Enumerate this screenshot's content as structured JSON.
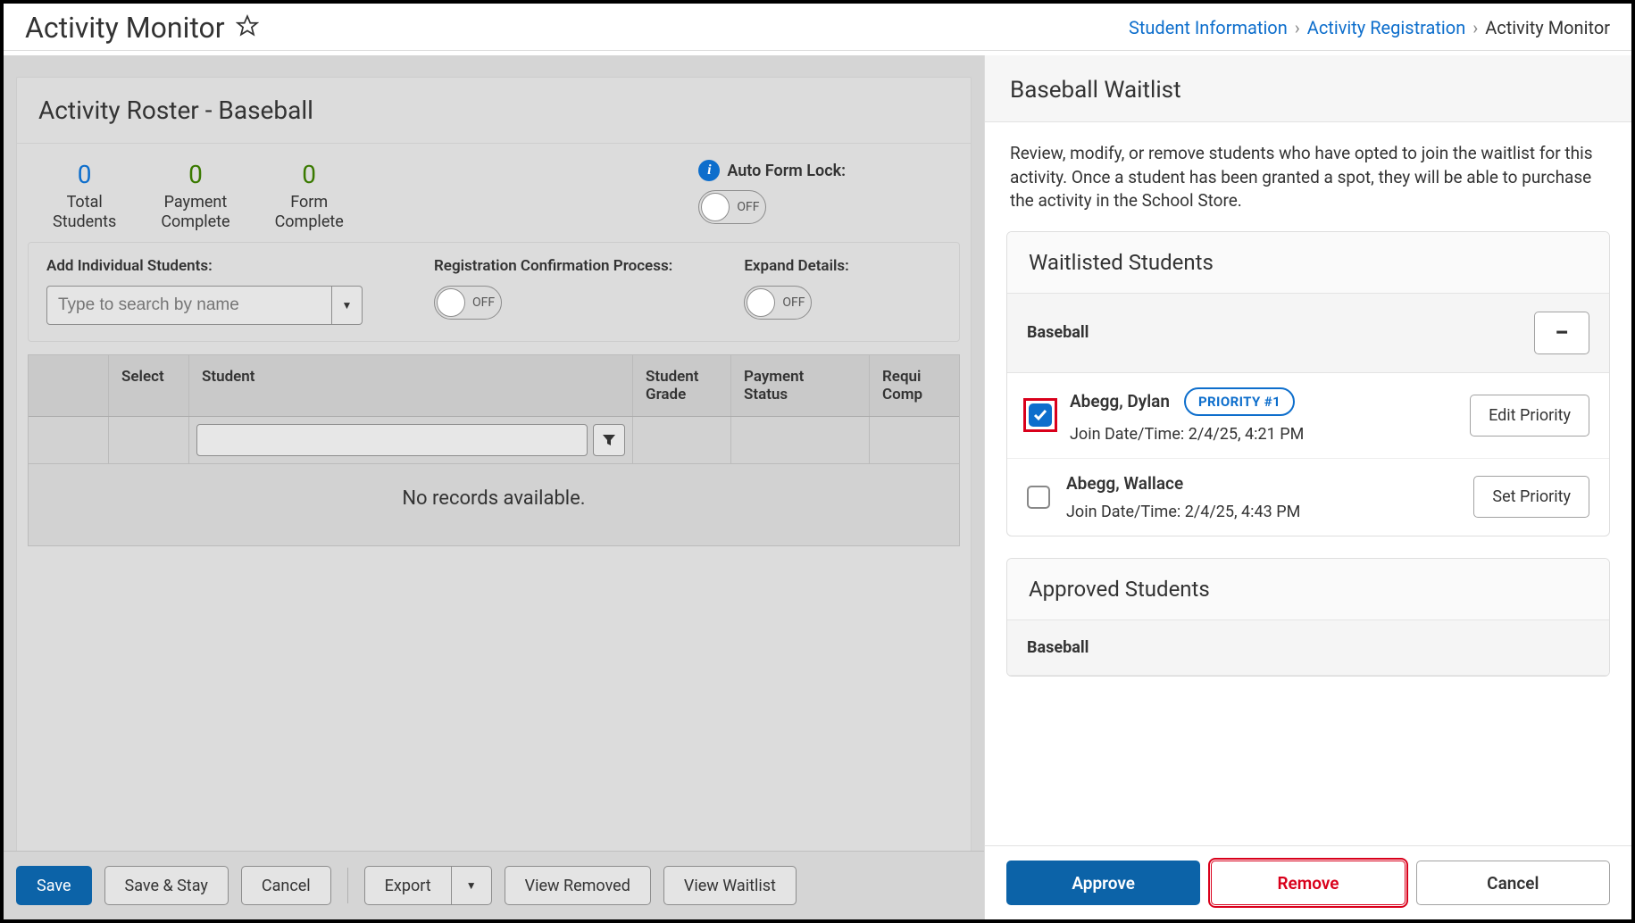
{
  "header": {
    "title": "Activity Monitor",
    "breadcrumbs": {
      "items": [
        {
          "label": "Student Information",
          "link": true
        },
        {
          "label": "Activity Registration",
          "link": true
        },
        {
          "label": "Activity Monitor",
          "link": false
        }
      ]
    }
  },
  "roster": {
    "title": "Activity Roster - Baseball",
    "stats": [
      {
        "value": "0",
        "label_line1": "Total",
        "label_line2": "Students",
        "color": "blue"
      },
      {
        "value": "0",
        "label_line1": "Payment",
        "label_line2": "Complete",
        "color": "green"
      },
      {
        "value": "0",
        "label_line1": "Form",
        "label_line2": "Complete",
        "color": "green"
      }
    ],
    "auto_form_lock": {
      "label": "Auto Form Lock:",
      "state": "OFF"
    },
    "add_students": {
      "label": "Add Individual Students:",
      "placeholder": "Type to search by name"
    },
    "reg_confirm": {
      "label": "Registration Confirmation Process:",
      "state": "OFF"
    },
    "expand_details": {
      "label": "Expand Details:",
      "state": "OFF"
    },
    "table": {
      "headers": {
        "select": "Select",
        "student": "Student",
        "grade": "Student Grade",
        "payment": "Payment Status",
        "required": "Requi\nComp"
      },
      "no_records": "No records available."
    }
  },
  "left_footer": {
    "save": "Save",
    "save_stay": "Save & Stay",
    "cancel": "Cancel",
    "export": "Export",
    "view_removed": "View Removed",
    "view_waitlist": "View Waitlist"
  },
  "waitlist_panel": {
    "title": "Baseball Waitlist",
    "description": "Review, modify, or remove students who have opted to join the waitlist for this activity. Once a student has been granted a spot, they will be able to purchase the activity in the School Store.",
    "waitlisted": {
      "heading": "Waitlisted Students",
      "activity": "Baseball",
      "students": [
        {
          "checked": true,
          "highlighted": true,
          "name": "Abegg, Dylan",
          "priority": "PRIORITY #1",
          "join_label": "Join Date/Time:",
          "join_value": "2/4/25, 4:21 PM",
          "button": "Edit Priority"
        },
        {
          "checked": false,
          "highlighted": false,
          "name": "Abegg, Wallace",
          "priority": "",
          "join_label": "Join Date/Time:",
          "join_value": "2/4/25, 4:43 PM",
          "button": "Set Priority"
        }
      ]
    },
    "approved": {
      "heading": "Approved Students",
      "activity": "Baseball"
    },
    "footer": {
      "approve": "Approve",
      "remove": "Remove",
      "cancel": "Cancel"
    }
  }
}
